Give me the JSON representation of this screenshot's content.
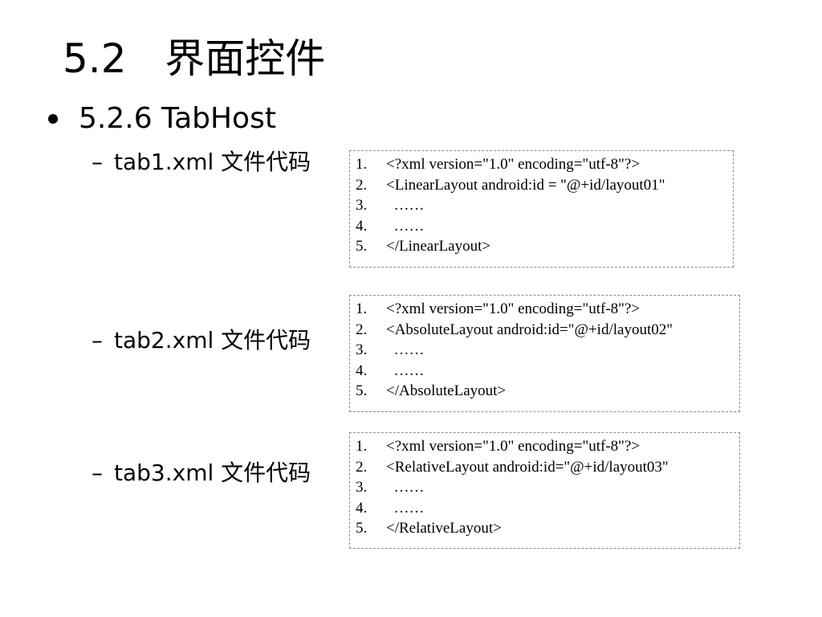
{
  "slide": {
    "title": "5.2   界面控件",
    "bullet": "5.2.6 TabHost",
    "sub_items": [
      {
        "dash": "–",
        "label": "tab1.xml 文件代码",
        "code": [
          {
            "num": "1.",
            "text": "<?xml version=\"1.0\" encoding=\"utf-8\"?>"
          },
          {
            "num": "2.",
            "text": "<LinearLayout android:id = \"@+id/layout01\""
          },
          {
            "num": "3.",
            "text": "  ……"
          },
          {
            "num": "4.",
            "text": "  ……"
          },
          {
            "num": "5.",
            "text": "</LinearLayout>"
          }
        ]
      },
      {
        "dash": "–",
        "label": "tab2.xml 文件代码",
        "code": [
          {
            "num": "1.",
            "text": "<?xml version=\"1.0\" encoding=\"utf-8\"?>"
          },
          {
            "num": "2.",
            "text": "<AbsoluteLayout android:id=\"@+id/layout02\""
          },
          {
            "num": "3.",
            "text": "  ……"
          },
          {
            "num": "4.",
            "text": "  ……"
          },
          {
            "num": "5.",
            "text": "</AbsoluteLayout>"
          }
        ]
      },
      {
        "dash": "–",
        "label": "tab3.xml 文件代码",
        "code": [
          {
            "num": "1.",
            "text": "<?xml version=\"1.0\" encoding=\"utf-8\"?>"
          },
          {
            "num": "2.",
            "text": "<RelativeLayout android:id=\"@+id/layout03\""
          },
          {
            "num": "3.",
            "text": "  ……"
          },
          {
            "num": "4.",
            "text": "  ……"
          },
          {
            "num": "5.",
            "text": "</RelativeLayout>"
          }
        ]
      }
    ]
  }
}
